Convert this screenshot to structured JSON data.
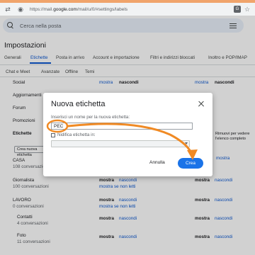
{
  "browser": {
    "url_prefix": "https://mail.",
    "url_domain": "google.com",
    "url_path": "/mail/u/0/#settings/labels"
  },
  "search": {
    "placeholder": "Cerca nella posta"
  },
  "page": {
    "title": "Impostazioni"
  },
  "tabs": [
    "Generali",
    "Etichette",
    "Posta in arrivo",
    "Account e importazione",
    "Filtri e indirizzi bloccati",
    "Inoltro e POP/IMAP"
  ],
  "tabs2": [
    "Chat e Meet",
    "Avanzate",
    "Offline",
    "Temi"
  ],
  "background": {
    "rows": [
      {
        "label": "Social",
        "show": "mostra",
        "hide": "nascondi",
        "show2": "mostra",
        "hide2": "nascondi"
      },
      {
        "label": "Aggiornamenti"
      },
      {
        "label": "Forum"
      },
      {
        "label": "Promozioni"
      }
    ],
    "section_header": "Etichette",
    "create_button": "Crea nuova etichetta",
    "side_note": "Rimuovi per vedere l'elenco completo",
    "side_note2": "mostra",
    "labels": [
      {
        "name": "CASA",
        "count": "108 conversazioni"
      },
      {
        "name": "Giornalista",
        "count": "100 conversazioni",
        "show": "mostra",
        "hide": "nascondi",
        "show_unread": "mostra se non letti",
        "show2": "mostra",
        "hide2": "nascondi"
      },
      {
        "name": "LAVORO",
        "count": "0 conversazioni",
        "show": "mostra",
        "hide": "nascondi",
        "show_unread": "mostra se non letti",
        "show2": "mostra",
        "hide2": "nascondi"
      },
      {
        "name": "Contatti",
        "count": "4 conversazioni",
        "show": "mostra",
        "hide": "nascondi",
        "show2": "mostra",
        "hide2": "nascondi"
      },
      {
        "name": "Foto",
        "count": "11 conversazioni",
        "show": "mostra",
        "hide": "nascondi",
        "show2": "mostra",
        "hide2": "nascondi"
      }
    ],
    "right_links": [
      "mostra",
      "nascondi"
    ]
  },
  "dialog": {
    "title": "Nuova etichetta",
    "prompt": "Inserisci un nome per la nuova etichetta:",
    "name_value": "PEC",
    "nest_label": "Nidifica etichetta in:",
    "cancel_label": "Annulla",
    "create_label": "Crea"
  },
  "colors": {
    "accent": "#1a73e8",
    "annotation": "#f08a24",
    "link": "#0b57d0"
  }
}
